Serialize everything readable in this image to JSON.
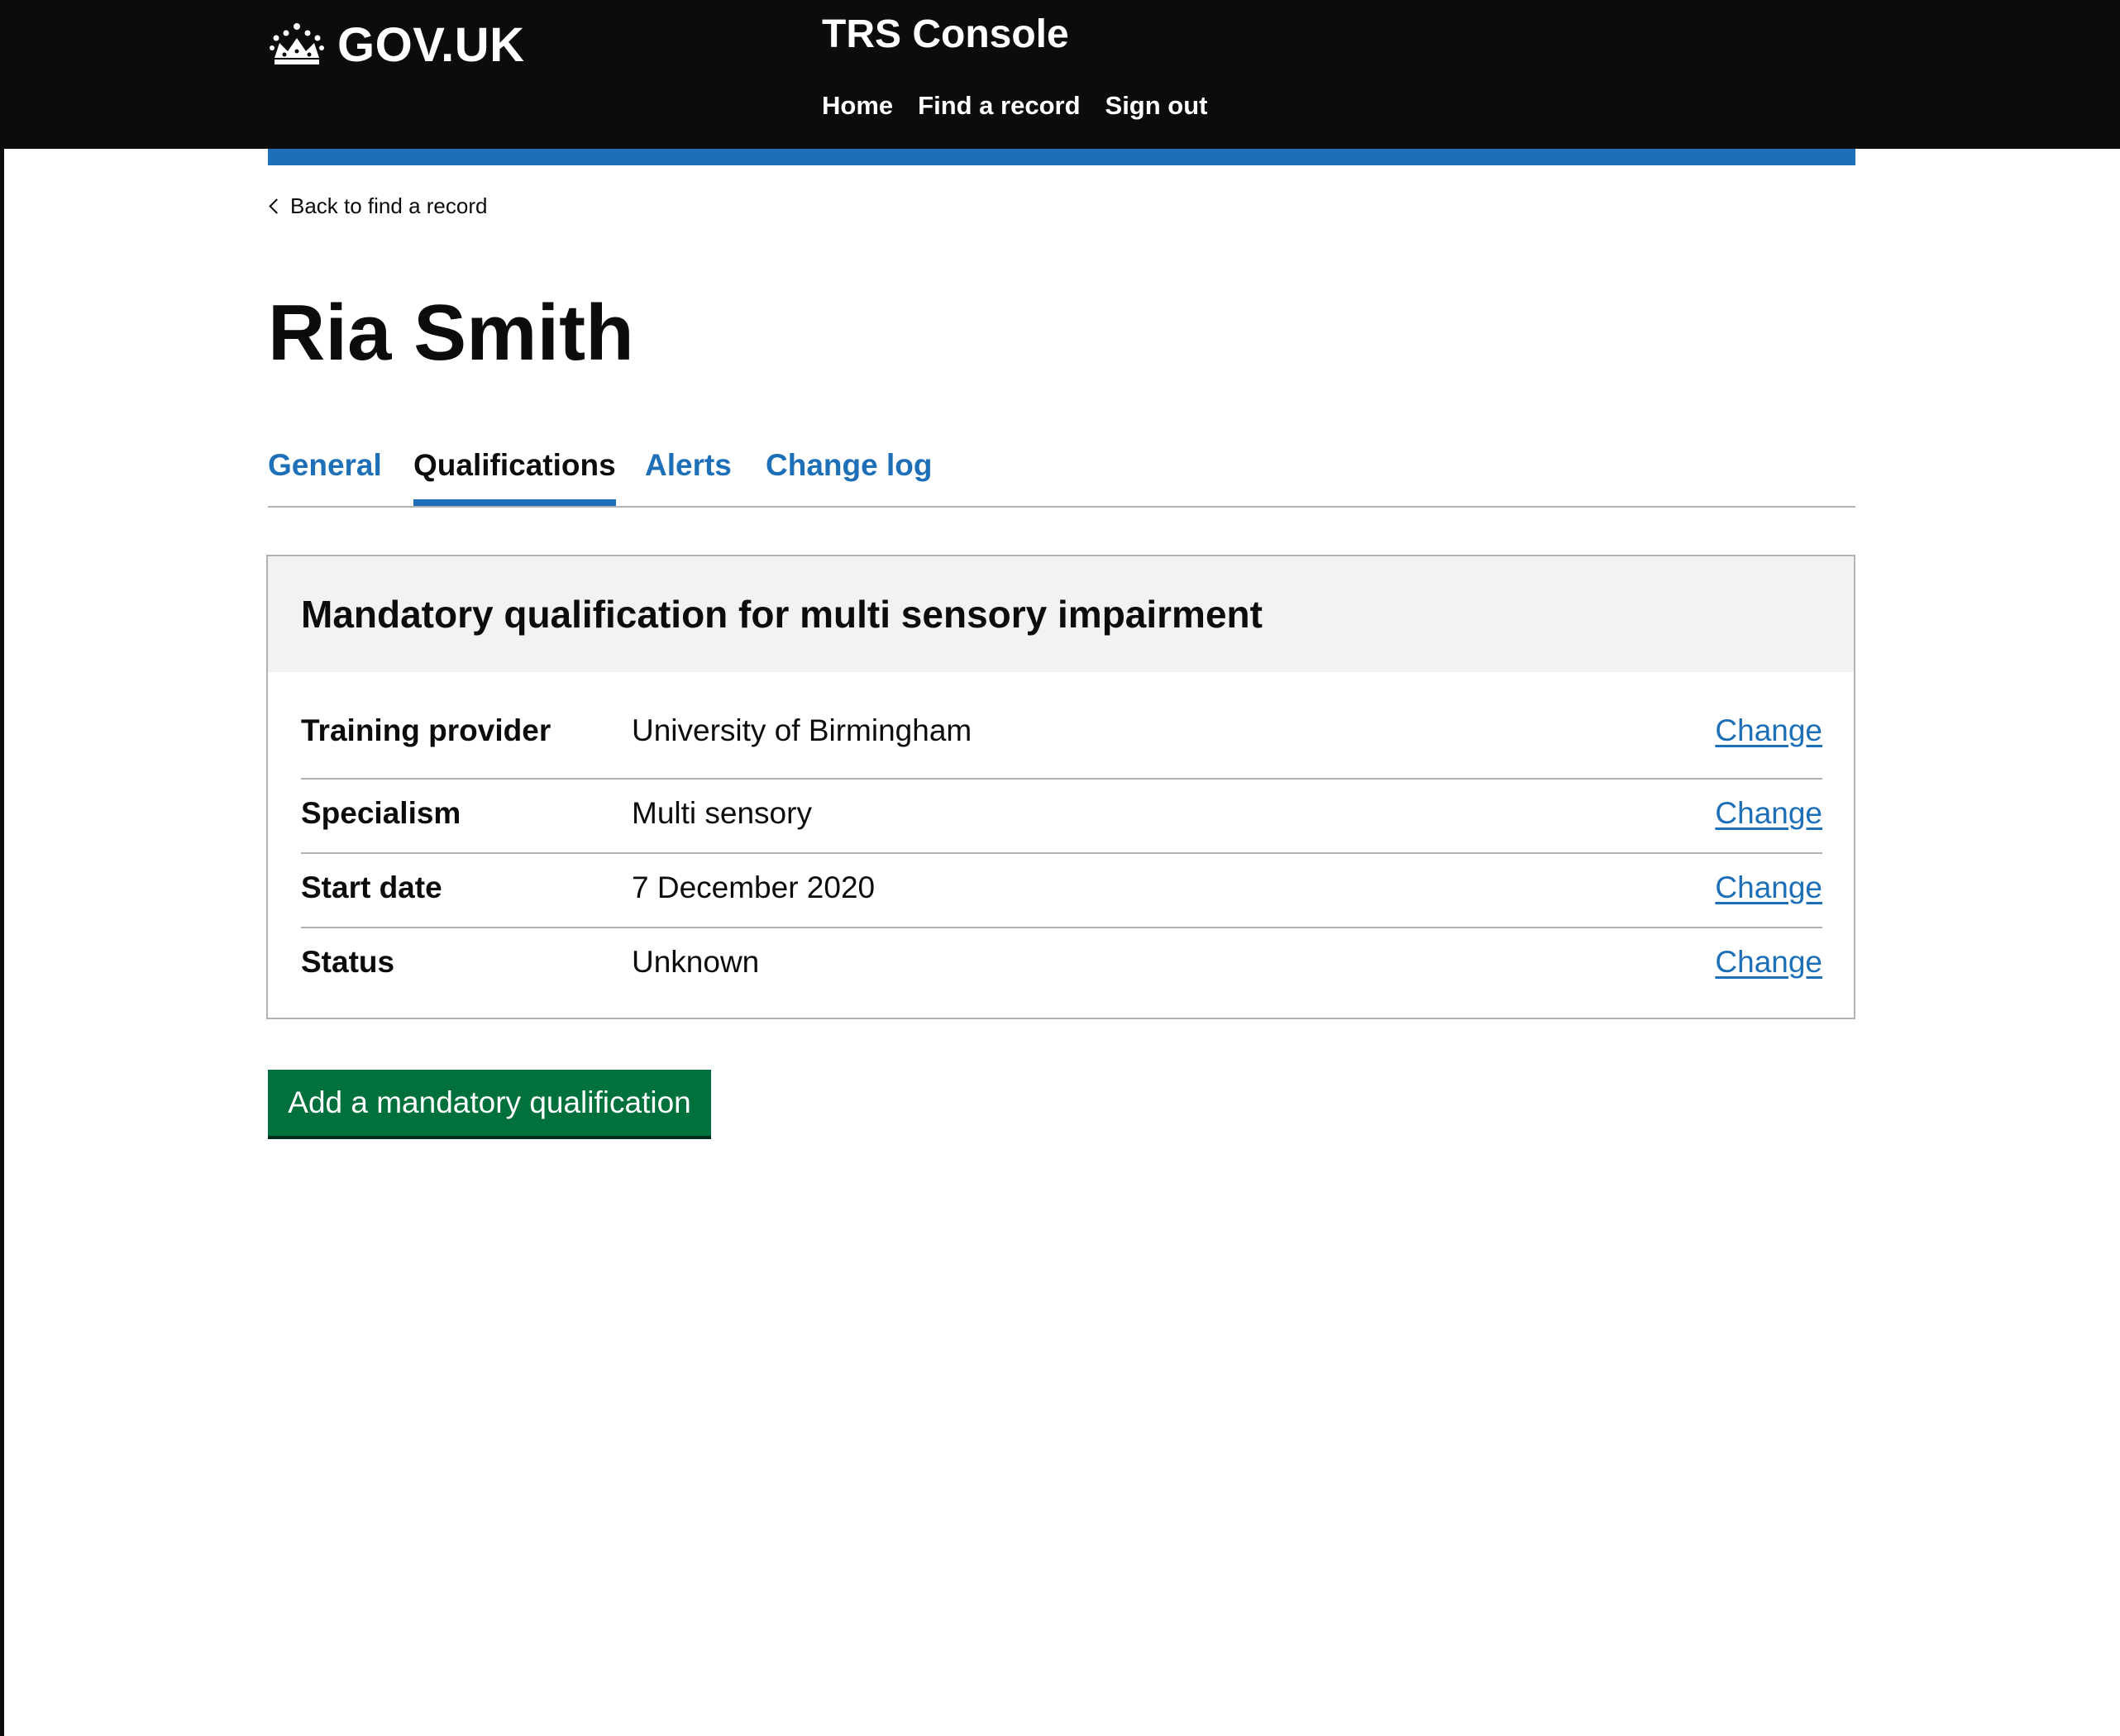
{
  "header": {
    "logo_text": "GOV.UK",
    "service_name": "TRS Console",
    "nav": [
      {
        "label": "Home"
      },
      {
        "label": "Find a record"
      },
      {
        "label": "Sign out"
      }
    ]
  },
  "back_link": {
    "label": "Back to find a record"
  },
  "page": {
    "title": "Ria Smith"
  },
  "tabs": [
    {
      "label": "General",
      "active": false
    },
    {
      "label": "Qualifications",
      "active": true
    },
    {
      "label": "Alerts",
      "active": false
    },
    {
      "label": "Change log",
      "active": false
    }
  ],
  "card": {
    "title": "Mandatory qualification for multi sensory impairment",
    "rows": [
      {
        "key": "Training provider",
        "value": "University of Birmingham",
        "action": "Change"
      },
      {
        "key": "Specialism",
        "value": "Multi sensory",
        "action": "Change"
      },
      {
        "key": "Start date",
        "value": "7 December 2020",
        "action": "Change"
      },
      {
        "key": "Status",
        "value": "Unknown",
        "action": "Change"
      }
    ]
  },
  "actions": {
    "add_button": "Add a mandatory qualification"
  },
  "colors": {
    "header_bg": "#0b0c0c",
    "link_blue": "#1d70b8",
    "button_green": "#00703c",
    "card_header_bg": "#f3f2f1",
    "border_grey": "#b1b4b6"
  }
}
